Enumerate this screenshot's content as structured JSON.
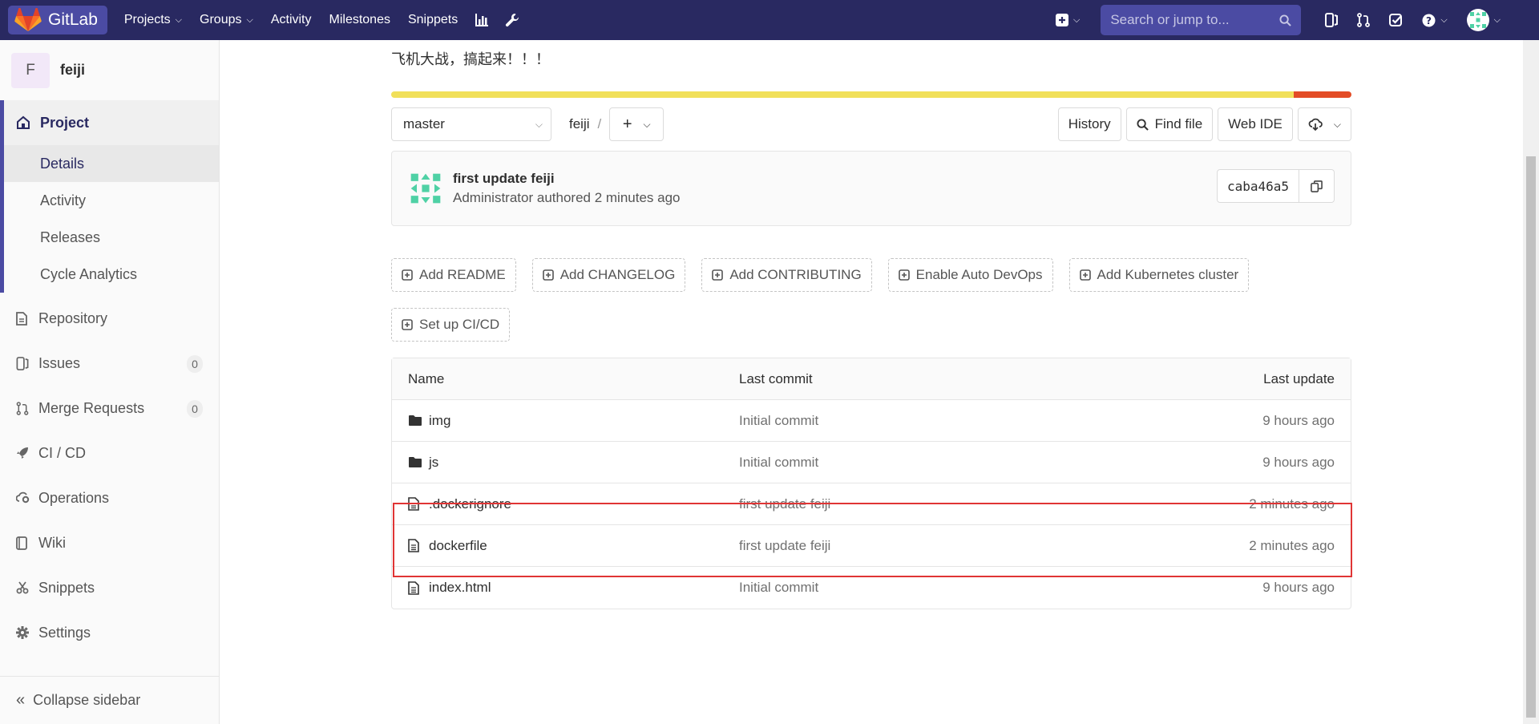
{
  "navbar": {
    "brand": "GitLab",
    "links": [
      {
        "label": "Projects",
        "dropdown": true
      },
      {
        "label": "Groups",
        "dropdown": true
      },
      {
        "label": "Activity",
        "dropdown": false
      },
      {
        "label": "Milestones",
        "dropdown": false
      },
      {
        "label": "Snippets",
        "dropdown": false
      }
    ],
    "search_placeholder": "Search or jump to...",
    "icons": [
      "chart-icon",
      "wrench-icon",
      "plus-square-icon",
      "issues-icon",
      "merge-request-icon",
      "todo-icon",
      "help-icon",
      "user-avatar"
    ]
  },
  "sidebar": {
    "project_initial": "F",
    "project_name": "feiji",
    "section_label": "Project",
    "sub_items": [
      "Details",
      "Activity",
      "Releases",
      "Cycle Analytics"
    ],
    "items": [
      {
        "label": "Repository",
        "icon": "doc-icon"
      },
      {
        "label": "Issues",
        "icon": "issues-icon",
        "badge": "0"
      },
      {
        "label": "Merge Requests",
        "icon": "merge-request-icon",
        "badge": "0"
      },
      {
        "label": "CI / CD",
        "icon": "rocket-icon"
      },
      {
        "label": "Operations",
        "icon": "cloud-gear-icon"
      },
      {
        "label": "Wiki",
        "icon": "book-icon"
      },
      {
        "label": "Snippets",
        "icon": "scissors-icon"
      },
      {
        "label": "Settings",
        "icon": "gear-icon"
      }
    ],
    "collapse_label": "Collapse sidebar"
  },
  "main": {
    "description": "飞机大战，搞起来！！！",
    "language_bar": [
      {
        "color": "#f1e05a",
        "percent": 94
      },
      {
        "color": "#e34c26",
        "percent": 6
      }
    ],
    "branch": "master",
    "path_root": "feiji",
    "buttons": {
      "history": "History",
      "find_file": "Find file",
      "web_ide": "Web IDE"
    },
    "commit": {
      "title": "first update feiji",
      "meta": "Administrator authored 2 minutes ago",
      "sha": "caba46a5"
    },
    "actions": [
      "Add README",
      "Add CHANGELOG",
      "Add CONTRIBUTING",
      "Enable Auto DevOps",
      "Add Kubernetes cluster",
      "Set up CI/CD"
    ],
    "table": {
      "headers": {
        "name": "Name",
        "commit": "Last commit",
        "update": "Last update"
      },
      "rows": [
        {
          "name": "img",
          "type": "folder",
          "commit": "Initial commit",
          "update": "9 hours ago"
        },
        {
          "name": "js",
          "type": "folder",
          "commit": "Initial commit",
          "update": "9 hours ago"
        },
        {
          "name": ".dockerignore",
          "type": "file",
          "commit": "first update feiji",
          "update": "2 minutes ago"
        },
        {
          "name": "dockerfile",
          "type": "file",
          "commit": "first update feiji",
          "update": "2 minutes ago"
        },
        {
          "name": "index.html",
          "type": "file",
          "commit": "Initial commit",
          "update": "9 hours ago"
        }
      ]
    }
  },
  "colors": {
    "navbar": "#292961",
    "navbar_accent": "#4b4ba3",
    "highlight_box": "#e03535"
  }
}
